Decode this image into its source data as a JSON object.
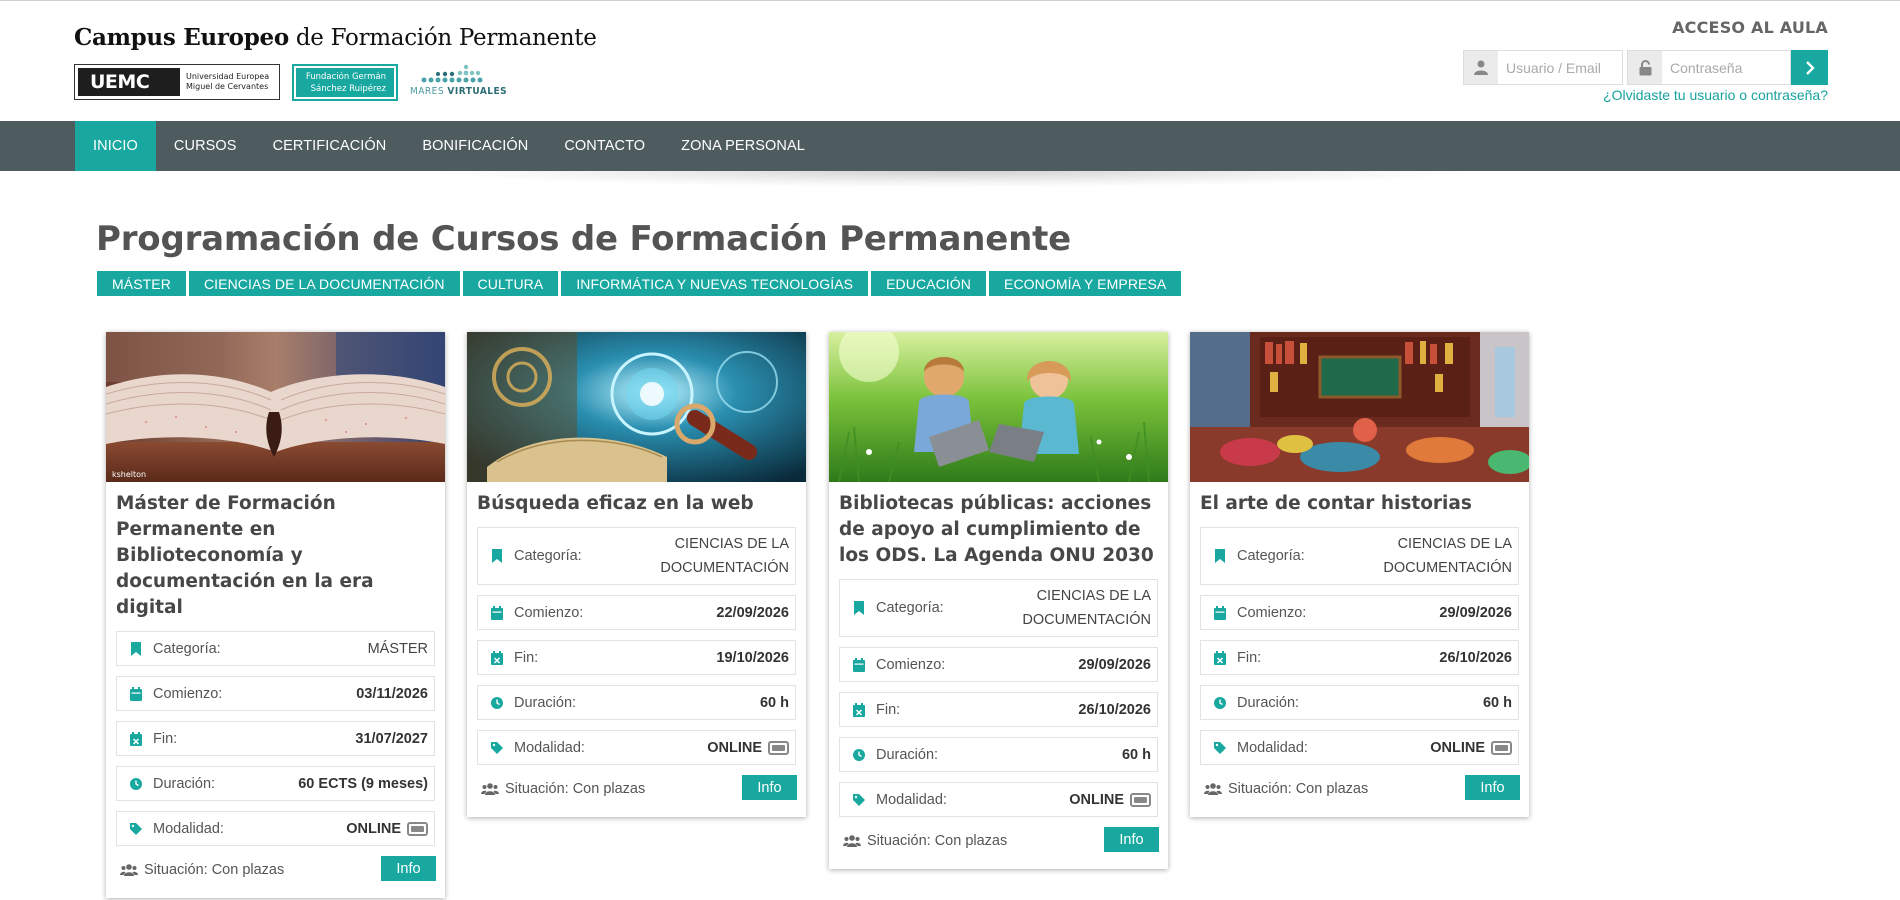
{
  "header": {
    "brand_bold": "Campus Europeo",
    "brand_rest": " de Formación Permanente",
    "logo_uemc": "UEMC",
    "logo_uemc_sub1": "Universidad Europea",
    "logo_uemc_sub2": "Miguel de Cervantes",
    "logo_fgsr_line1": "Fundación  Germán",
    "logo_fgsr_line2": "Sánchez Ruipérez",
    "logo_mares_a": "MARES",
    "logo_mares_b": "VIRTUALES"
  },
  "login": {
    "title": "ACCESO AL AULA",
    "user_placeholder": "Usuario / Email",
    "pass_placeholder": "Contraseña",
    "forgot": "¿Olvidaste tu usuario o contraseña?"
  },
  "nav": {
    "items": [
      "INICIO",
      "CURSOS",
      "CERTIFICACIÓN",
      "BONIFICACIÓN",
      "CONTACTO",
      "ZONA PERSONAL"
    ]
  },
  "main": {
    "title": "Programación de Cursos de Formación Permanente",
    "filters": [
      "MÁSTER",
      "CIENCIAS DE LA DOCUMENTACIÓN",
      "CULTURA",
      "INFORMÁTICA Y NUEVAS TECNOLOGÍAS",
      "EDUCACIÓN",
      "ECONOMÍA Y EMPRESA"
    ]
  },
  "labels": {
    "categoria": "Categoría:",
    "comienzo": "Comienzo:",
    "fin": "Fin:",
    "duracion": "Duración:",
    "modalidad": "Modalidad:",
    "situacion": "Situación: Con plazas",
    "info": "Info"
  },
  "cards": [
    {
      "title": "Máster de Formación Permanente en Biblioteconomía y documentación en la era digital",
      "image_credit": "kshelton",
      "categoria": "MÁSTER",
      "comienzo": "03/11/2026",
      "fin": "31/07/2027",
      "duracion": "60 ECTS (9 meses)",
      "modalidad": "ONLINE"
    },
    {
      "title": "Búsqueda eficaz en la web",
      "categoria_1": "CIENCIAS DE LA",
      "categoria_2": "DOCUMENTACIÓN",
      "comienzo": "22/09/2026",
      "fin": "19/10/2026",
      "duracion": "60 h",
      "modalidad": "ONLINE"
    },
    {
      "title": "Bibliotecas públicas: acciones de apoyo al cumplimiento de los ODS. La Agenda ONU 2030",
      "categoria_1": "CIENCIAS DE LA",
      "categoria_2": "DOCUMENTACIÓN",
      "comienzo": "29/09/2026",
      "fin": "26/10/2026",
      "duracion": "60 h",
      "modalidad": "ONLINE"
    },
    {
      "title": "El arte de contar historias",
      "categoria_1": "CIENCIAS DE LA",
      "categoria_2": "DOCUMENTACIÓN",
      "comienzo": "29/09/2026",
      "fin": "26/10/2026",
      "duracion": "60 h",
      "modalidad": "ONLINE"
    }
  ],
  "colors": {
    "accent": "#18a8a0",
    "nav_bg": "#4e5c5f",
    "title": "#545454"
  }
}
